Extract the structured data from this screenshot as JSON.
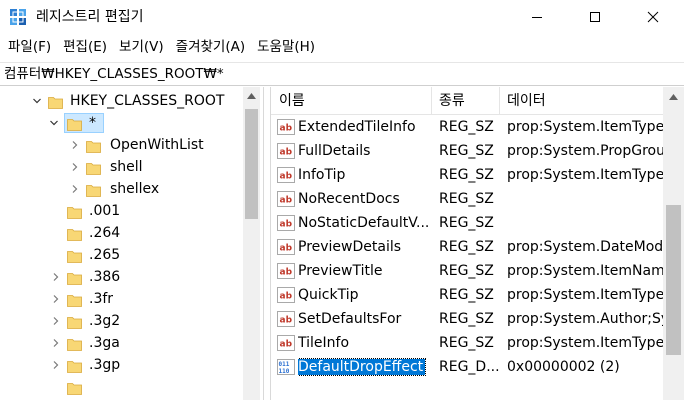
{
  "window": {
    "title": "레지스트리 편집기",
    "icon": "regedit-icon",
    "controls": [
      "minimize-icon",
      "maximize-icon",
      "close-icon"
    ]
  },
  "menu": {
    "items": [
      {
        "label": "파일(F)"
      },
      {
        "label": "편집(E)"
      },
      {
        "label": "보기(V)"
      },
      {
        "label": "즐겨찾기(A)"
      },
      {
        "label": "도움말(H)"
      }
    ]
  },
  "address": {
    "path": "컴퓨터₩HKEY_CLASSES_ROOT₩*"
  },
  "tree": {
    "items": [
      {
        "label": "HKEY_CLASSES_ROOT",
        "expanded": true
      },
      {
        "label": "*",
        "expanded": true,
        "selected": true
      },
      {
        "label": "OpenWithList",
        "expanded": false
      },
      {
        "label": "shell",
        "expanded": false
      },
      {
        "label": "shellex",
        "expanded": false
      },
      {
        "label": ".001",
        "expanded": false
      },
      {
        "label": ".264",
        "expanded": false
      },
      {
        "label": ".265",
        "expanded": false
      },
      {
        "label": ".386",
        "expanded": false
      },
      {
        "label": ".3fr",
        "expanded": false
      },
      {
        "label": ".3g2",
        "expanded": false
      },
      {
        "label": ".3ga",
        "expanded": false
      },
      {
        "label": ".3gp",
        "expanded": false
      }
    ]
  },
  "list": {
    "columns": [
      {
        "label": "이름"
      },
      {
        "label": "종류"
      },
      {
        "label": "데이터"
      }
    ],
    "rows": [
      {
        "name": "ExtendedTileInfo",
        "type": "REG_SZ",
        "data": "prop:System.ItemTypeT",
        "icon": "string-value-icon"
      },
      {
        "name": "FullDetails",
        "type": "REG_SZ",
        "data": "prop:System.PropGroup",
        "icon": "string-value-icon"
      },
      {
        "name": "InfoTip",
        "type": "REG_SZ",
        "data": "prop:System.ItemTypeT",
        "icon": "string-value-icon"
      },
      {
        "name": "NoRecentDocs",
        "type": "REG_SZ",
        "data": "",
        "icon": "string-value-icon"
      },
      {
        "name": "NoStaticDefaultV...",
        "type": "REG_SZ",
        "data": "",
        "icon": "string-value-icon"
      },
      {
        "name": "PreviewDetails",
        "type": "REG_SZ",
        "data": "prop:System.DateModif",
        "icon": "string-value-icon"
      },
      {
        "name": "PreviewTitle",
        "type": "REG_SZ",
        "data": "prop:System.ItemName",
        "icon": "string-value-icon"
      },
      {
        "name": "QuickTip",
        "type": "REG_SZ",
        "data": "prop:System.ItemTypeT",
        "icon": "string-value-icon"
      },
      {
        "name": "SetDefaultsFor",
        "type": "REG_SZ",
        "data": "prop:System.Author;Sys",
        "icon": "string-value-icon"
      },
      {
        "name": "TileInfo",
        "type": "REG_SZ",
        "data": "prop:System.ItemTypeT",
        "icon": "string-value-icon"
      },
      {
        "name": "DefaultDropEffect",
        "type": "REG_D...",
        "data": "0x00000002 (2)",
        "icon": "dword-value-icon",
        "selected": true
      }
    ]
  },
  "colors": {
    "selection": "#0078d7",
    "tree_selection": "#cce8ff",
    "folder": "#f8d775",
    "string_icon": "#c0392b",
    "dword_icon": "#2a6fd1"
  }
}
